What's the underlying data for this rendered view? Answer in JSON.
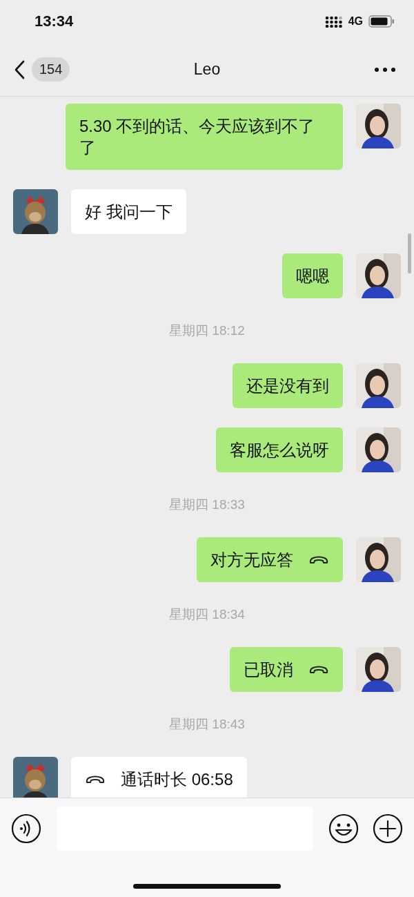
{
  "status_bar": {
    "time": "13:34",
    "network": "4G"
  },
  "nav": {
    "unread": "154",
    "title": "Leo"
  },
  "messages": [
    {
      "kind": "text",
      "from_me": true,
      "text": "5.30 不到的话、今天应该到不了了"
    },
    {
      "kind": "text",
      "from_me": false,
      "text": "好 我问一下"
    },
    {
      "kind": "text",
      "from_me": true,
      "text": "嗯嗯"
    },
    {
      "kind": "time",
      "text": "星期四 18:12"
    },
    {
      "kind": "text",
      "from_me": true,
      "text": "还是没有到"
    },
    {
      "kind": "text",
      "from_me": true,
      "text": "客服怎么说呀"
    },
    {
      "kind": "time",
      "text": "星期四 18:33"
    },
    {
      "kind": "call",
      "from_me": true,
      "text": "对方无应答"
    },
    {
      "kind": "time",
      "text": "星期四 18:34"
    },
    {
      "kind": "call",
      "from_me": true,
      "text": "已取消"
    },
    {
      "kind": "time",
      "text": "星期四 18:43"
    },
    {
      "kind": "call",
      "from_me": false,
      "text": "通话时长 06:58"
    }
  ]
}
